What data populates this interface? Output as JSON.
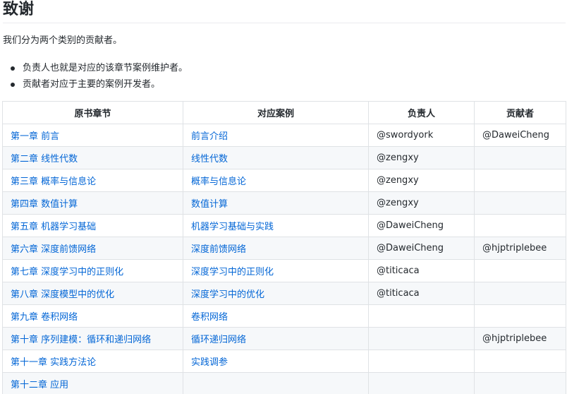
{
  "title": "致谢",
  "intro": "我们分为两个类别的贡献者。",
  "bullets": [
    "负责人也就是对应的该章节案例维护者。",
    "贡献者对应于主要的案例开发者。"
  ],
  "table": {
    "headers": [
      "原书章节",
      "对应案例",
      "负责人",
      "贡献者"
    ],
    "rows": [
      {
        "chapter": "第一章 前言",
        "case": "前言介绍",
        "owner": "@swordyork",
        "contributor": "@DaweiCheng"
      },
      {
        "chapter": "第二章 线性代数",
        "case": "线性代数",
        "owner": "@zengxy",
        "contributor": ""
      },
      {
        "chapter": "第三章 概率与信息论",
        "case": "概率与信息论",
        "owner": "@zengxy",
        "contributor": ""
      },
      {
        "chapter": "第四章 数值计算",
        "case": "数值计算",
        "owner": "@zengxy",
        "contributor": ""
      },
      {
        "chapter": "第五章 机器学习基础",
        "case": "机器学习基础与实践",
        "owner": "@DaweiCheng",
        "contributor": ""
      },
      {
        "chapter": "第六章 深度前馈网络",
        "case": "深度前馈网络",
        "owner": "@DaweiCheng",
        "contributor": "@hjptriplebee"
      },
      {
        "chapter": "第七章 深度学习中的正则化",
        "case": "深度学习中的正则化",
        "owner": "@titicaca",
        "contributor": ""
      },
      {
        "chapter": "第八章 深度模型中的优化",
        "case": "深度学习中的优化",
        "owner": "@titicaca",
        "contributor": ""
      },
      {
        "chapter": "第九章 卷积网络",
        "case": "卷积网络",
        "owner": "",
        "contributor": ""
      },
      {
        "chapter": "第十章 序列建模：循环和递归网络",
        "case": "循环递归网络",
        "owner": "",
        "contributor": "@hjptriplebee"
      },
      {
        "chapter": "第十一章 实践方法论",
        "case": "实践调参",
        "owner": "",
        "contributor": ""
      },
      {
        "chapter": "第十二章 应用",
        "case": "",
        "owner": "",
        "contributor": ""
      }
    ]
  }
}
